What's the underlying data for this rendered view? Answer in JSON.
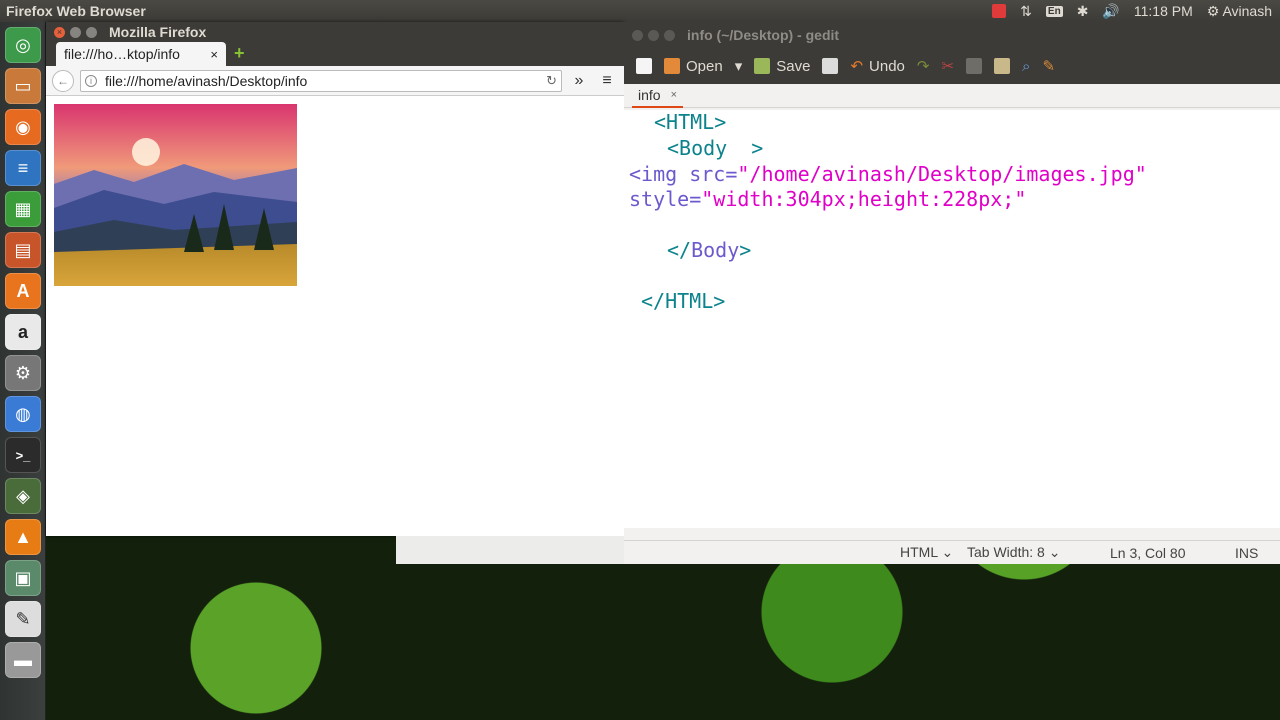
{
  "top_panel": {
    "app_title": "Firefox Web Browser",
    "keyboard_layout": "En",
    "time": "11:18 PM",
    "user": "Avinash"
  },
  "launcher": {
    "items": [
      "dash",
      "files",
      "firefox",
      "writer",
      "calc",
      "impress",
      "software-center",
      "amazon",
      "system-settings",
      "chromium",
      "terminal",
      "workspace",
      "vlc",
      "image-viewer",
      "text-editor",
      "drive"
    ]
  },
  "firefox": {
    "window_title": "Mozilla Firefox",
    "tab_label": "file:///ho…ktop/info",
    "url": "file:///home/avinash/Desktop/info",
    "image_alt": "mountain landscape"
  },
  "gedit": {
    "window_title": "info (~/Desktop) - gedit",
    "toolbar": {
      "open": "Open",
      "save": "Save",
      "undo": "Undo"
    },
    "tab_label": "info",
    "code": {
      "line1": "<HTML>",
      "line2": "<Body  >",
      "line3_tag": "<img ",
      "line3_attr": "src=",
      "line3_val": "\"/home/avinash/Desktop/images.jpg\"",
      "line4_attr": "style=",
      "line4_val": "\"width:304px;height:228px;\"",
      "line6_open": "</",
      "line6_name": "Body",
      "line6_close": ">",
      "line8": "</HTML>"
    },
    "status": {
      "language": "HTML",
      "tab_width": "Tab Width: 8",
      "position": "Ln 3, Col 80",
      "mode": "INS"
    }
  }
}
